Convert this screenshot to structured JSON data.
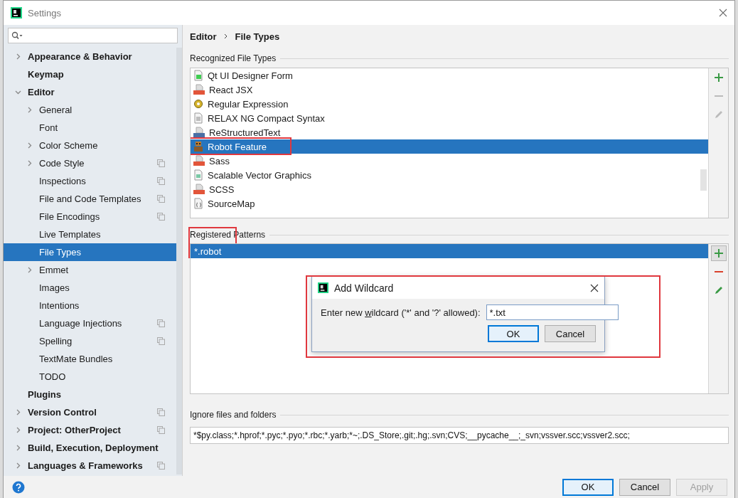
{
  "window": {
    "title": "Settings"
  },
  "sidebar": {
    "items": [
      {
        "label": "Appearance & Behavior",
        "expanded": false,
        "shared": false,
        "selected": false
      },
      {
        "label": "Keymap",
        "shared": false,
        "selected": false
      },
      {
        "label": "Editor",
        "expanded": true,
        "shared": false,
        "selected": false,
        "children": [
          {
            "label": "General",
            "expanded": false,
            "shared": false,
            "selected": false
          },
          {
            "label": "Font",
            "shared": false,
            "selected": false
          },
          {
            "label": "Color Scheme",
            "expanded": false,
            "shared": false,
            "selected": false
          },
          {
            "label": "Code Style",
            "expanded": false,
            "shared": true,
            "selected": false
          },
          {
            "label": "Inspections",
            "shared": true,
            "selected": false
          },
          {
            "label": "File and Code Templates",
            "shared": true,
            "selected": false
          },
          {
            "label": "File Encodings",
            "shared": true,
            "selected": false
          },
          {
            "label": "Live Templates",
            "shared": false,
            "selected": false
          },
          {
            "label": "File Types",
            "shared": false,
            "selected": true
          },
          {
            "label": "Emmet",
            "expanded": false,
            "shared": false,
            "selected": false
          },
          {
            "label": "Images",
            "shared": false,
            "selected": false
          },
          {
            "label": "Intentions",
            "shared": false,
            "selected": false
          },
          {
            "label": "Language Injections",
            "shared": true,
            "selected": false
          },
          {
            "label": "Spelling",
            "shared": true,
            "selected": false
          },
          {
            "label": "TextMate Bundles",
            "shared": false,
            "selected": false
          },
          {
            "label": "TODO",
            "shared": false,
            "selected": false
          }
        ]
      },
      {
        "label": "Plugins",
        "shared": false,
        "selected": false
      },
      {
        "label": "Version Control",
        "expanded": false,
        "shared": true,
        "selected": false
      },
      {
        "label": "Project: OtherProject",
        "expanded": false,
        "shared": true,
        "selected": false
      },
      {
        "label": "Build, Execution, Deployment",
        "expanded": false,
        "shared": false,
        "selected": false
      },
      {
        "label": "Languages & Frameworks",
        "expanded": false,
        "shared": true,
        "selected": false
      }
    ]
  },
  "breadcrumb": [
    "Editor",
    "File Types"
  ],
  "recognized_file_types": {
    "title": "Recognized File Types",
    "items": [
      {
        "label": "Qt UI Designer Form",
        "kind": "qt",
        "selected": false
      },
      {
        "label": "React JSX",
        "kind": "jsx",
        "selected": false
      },
      {
        "label": "Regular Expression",
        "kind": "regex",
        "selected": false
      },
      {
        "label": "RELAX NG Compact Syntax",
        "kind": "text",
        "selected": false
      },
      {
        "label": "ReStructuredText",
        "kind": "rst",
        "selected": false
      },
      {
        "label": "Robot Feature",
        "kind": "robot",
        "selected": true,
        "annotated": true
      },
      {
        "label": "Sass",
        "kind": "sass",
        "selected": false
      },
      {
        "label": "Scalable Vector Graphics",
        "kind": "svg",
        "selected": false
      },
      {
        "label": "SCSS",
        "kind": "sass",
        "selected": false
      },
      {
        "label": "SourceMap",
        "kind": "map",
        "selected": false
      }
    ],
    "toolbar": [
      {
        "kind": "add",
        "disabled": false
      },
      {
        "kind": "remove",
        "disabled": true
      },
      {
        "kind": "edit",
        "disabled": true
      }
    ]
  },
  "registered_patterns": {
    "title": "Registered Patterns",
    "annotated": true,
    "items": [
      {
        "label": "*.robot",
        "selected": true
      }
    ],
    "toolbar": [
      {
        "kind": "add",
        "disabled": false
      },
      {
        "kind": "remove",
        "disabled": false
      },
      {
        "kind": "edit",
        "disabled": false
      }
    ]
  },
  "dialog": {
    "title": "Add Wildcard",
    "annotated": true,
    "label_parts": [
      "Enter new ",
      "w",
      "ildcard ('*' and '?' allowed):"
    ],
    "value": "*.txt",
    "buttons": [
      {
        "label": "OK",
        "default": true
      },
      {
        "label": "Cancel",
        "default": false
      }
    ]
  },
  "ignore": {
    "label": "Ignore files and folders",
    "value": "*$py.class;*.hprof;*.pyc;*.pyo;*.rbc;*.yarb;*~;.DS_Store;.git;.hg;.svn;CVS;__pycache__;_svn;vssver.scc;vssver2.scc;"
  },
  "footer": {
    "buttons": [
      {
        "label": "OK",
        "default": true,
        "disabled": false
      },
      {
        "label": "Cancel",
        "default": false,
        "disabled": false
      },
      {
        "label": "Apply",
        "default": false,
        "disabled": true
      }
    ]
  }
}
